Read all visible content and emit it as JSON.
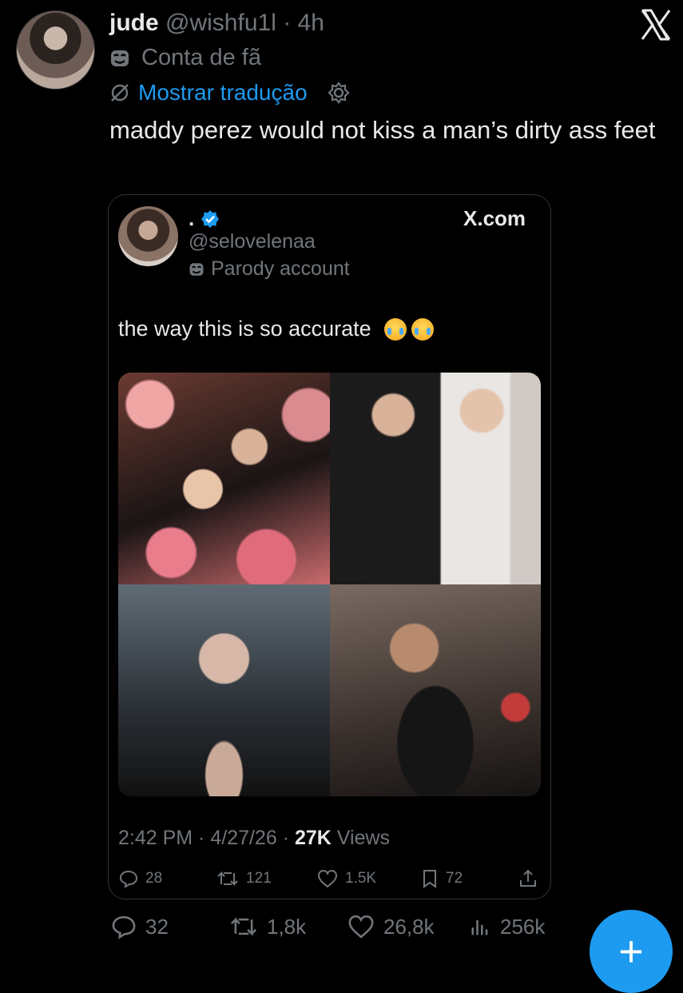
{
  "tweet": {
    "name": "jude",
    "handle": "@wishfu1l",
    "time": "4h",
    "fan_label": "Conta de fã",
    "translate_label": "Mostrar tradução",
    "text": "maddy perez would not kiss a man’s dirty ass feet",
    "stats": {
      "replies": "32",
      "reposts": "1,8k",
      "likes": "26,8k",
      "views": "256k"
    }
  },
  "quoted": {
    "name": ".",
    "handle": "@selovelenaa",
    "parody_label": "Parody account",
    "source": "X.com",
    "text": "the way this is so accurate",
    "time": "2:42 PM",
    "date": "4/27/26",
    "views_count": "27K",
    "views_label": "Views",
    "stats": {
      "replies": "28",
      "reposts": "121",
      "likes": "1.5K",
      "bookmarks": "72"
    }
  },
  "icons": {
    "close": "x-logo-icon",
    "fab": "compose-icon"
  },
  "colors": {
    "accent": "#1d9bf0",
    "muted": "#71767b",
    "text": "#e7e9ea",
    "background": "#000000"
  }
}
